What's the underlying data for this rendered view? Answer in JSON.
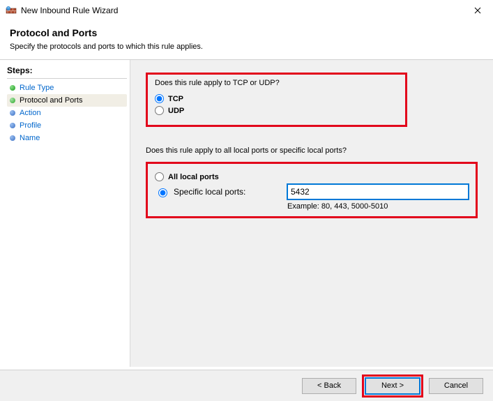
{
  "window": {
    "title": "New Inbound Rule Wizard"
  },
  "header": {
    "heading": "Protocol and Ports",
    "subtitle": "Specify the protocols and ports to which this rule applies."
  },
  "sidebar": {
    "title": "Steps:",
    "items": [
      {
        "label": "Rule Type",
        "state": "done"
      },
      {
        "label": "Protocol and Ports",
        "state": "current"
      },
      {
        "label": "Action",
        "state": "todo"
      },
      {
        "label": "Profile",
        "state": "todo"
      },
      {
        "label": "Name",
        "state": "todo"
      }
    ]
  },
  "content": {
    "q1": "Does this rule apply to TCP or UDP?",
    "tcp_label": "TCP",
    "udp_label": "UDP",
    "protocol_selected": "tcp",
    "q2": "Does this rule apply to all local ports or specific local ports?",
    "all_ports_label": "All local ports",
    "specific_ports_label": "Specific local ports:",
    "ports_selected": "specific",
    "ports_value": "5432",
    "example_label": "Example: 80, 443, 5000-5010"
  },
  "buttons": {
    "back": "< Back",
    "next": "Next >",
    "cancel": "Cancel"
  }
}
